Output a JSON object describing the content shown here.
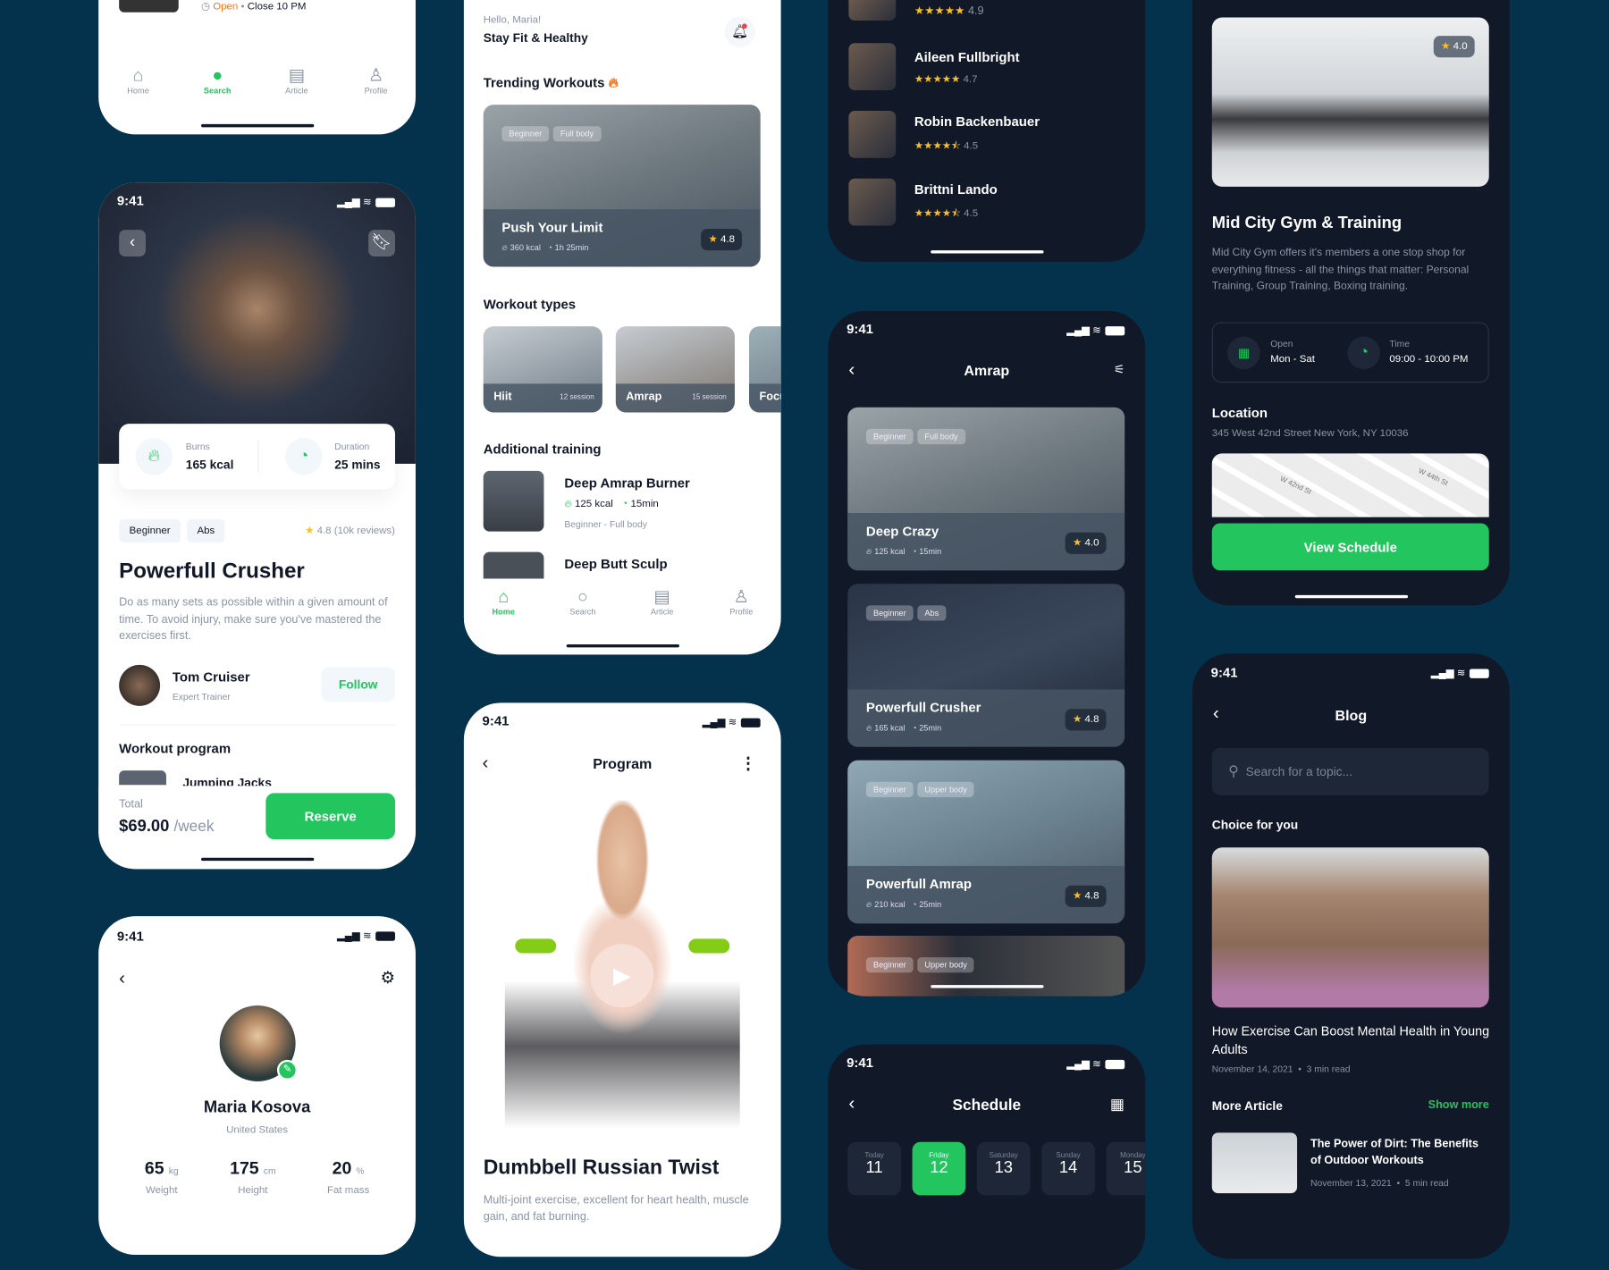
{
  "colors": {
    "background": "#04314b",
    "accent": "#22c55e",
    "dark_screen": "#111827",
    "star": "#fbbf24"
  },
  "status_time": "9:41",
  "gym_list": {
    "status_open": "Open",
    "closing": "Close 10 PM",
    "nav": [
      "Home",
      "Search",
      "Article",
      "Profile"
    ],
    "active_nav": "Search"
  },
  "detail": {
    "burns_label": "Burns",
    "burns": "165 kcal",
    "duration_label": "Duration",
    "duration": "25 mins",
    "tags": [
      "Beginner",
      "Abs"
    ],
    "rating": "4.8 (10k reviews)",
    "title": "Powerfull Crusher",
    "description": "Do as many sets as possible within a given amount of time. To avoid injury, make sure you've mastered the exercises first.",
    "trainer_name": "Tom Cruiser",
    "trainer_role": "Expert Trainer",
    "follow": "Follow",
    "program_heading": "Workout program",
    "program_item": "Jumping Jacks",
    "total_label": "Total",
    "price": "$69.00",
    "period": "/week",
    "reserve": "Reserve"
  },
  "profile": {
    "name": "Maria Kosova",
    "country": "United States",
    "stats": [
      {
        "value": "65",
        "unit": "kg",
        "label": "Weight"
      },
      {
        "value": "175",
        "unit": "cm",
        "label": "Height"
      },
      {
        "value": "20",
        "unit": "%",
        "label": "Fat mass"
      }
    ]
  },
  "home": {
    "greeting": "Hello, Maria!",
    "subtitle": "Stay Fit & Healthy",
    "trending_heading": "Trending Workouts",
    "trending": {
      "tags": [
        "Beginner",
        "Full body"
      ],
      "title": "Push Your Limit",
      "kcal": "360 kcal",
      "time": "1h 25min",
      "rating": "4.8"
    },
    "types_heading": "Workout types",
    "types": [
      {
        "name": "Hiit",
        "sessions": "12 session"
      },
      {
        "name": "Amrap",
        "sessions": "15 session"
      },
      {
        "name": "Focus",
        "sessions": ""
      }
    ],
    "additional_heading": "Additional training",
    "additional": [
      {
        "title": "Deep Amrap Burner",
        "kcal": "125 kcal",
        "time": "15min",
        "level": "Beginner - Full body"
      },
      {
        "title": "Deep Butt Sculp"
      }
    ],
    "nav": [
      "Home",
      "Search",
      "Article",
      "Profile"
    ],
    "active_nav": "Home"
  },
  "program": {
    "title": "Program",
    "exercise": "Dumbbell Russian Twist",
    "description": "Multi-joint exercise, excellent for heart health, muscle gain, and fat burning."
  },
  "trainers": [
    {
      "name": "",
      "rating": "4.9"
    },
    {
      "name": "Aileen Fullbright",
      "rating": "4.7"
    },
    {
      "name": "Robin Backenbauer",
      "rating": "4.5"
    },
    {
      "name": "Brittni Lando",
      "rating": "4.5"
    }
  ],
  "amrap": {
    "title": "Amrap",
    "cards": [
      {
        "tags": [
          "Beginner",
          "Full body"
        ],
        "title": "Deep Crazy",
        "kcal": "125 kcal",
        "time": "15min",
        "rating": "4.0"
      },
      {
        "tags": [
          "Beginner",
          "Abs"
        ],
        "title": "Powerfull Crusher",
        "kcal": "165 kcal",
        "time": "25min",
        "rating": "4.8"
      },
      {
        "tags": [
          "Beginner",
          "Upper body"
        ],
        "title": "Powerfull Amrap",
        "kcal": "210 kcal",
        "time": "25min",
        "rating": "4.8"
      },
      {
        "tags": [
          "Beginner",
          "Upper body"
        ]
      }
    ]
  },
  "schedule": {
    "title": "Schedule",
    "days": [
      {
        "label": "Today",
        "num": "11"
      },
      {
        "label": "Friday",
        "num": "12"
      },
      {
        "label": "Saturday",
        "num": "13"
      },
      {
        "label": "Sunday",
        "num": "14"
      },
      {
        "label": "Monday",
        "num": "15"
      }
    ],
    "selected": "12"
  },
  "gym": {
    "rating": "4.0",
    "name": "Mid City Gym & Training",
    "description": "Mid City Gym offers it's members a one stop shop for everything fitness - all the things that matter: Personal Training, Group Training, Boxing training.",
    "open_label": "Open",
    "open_days": "Mon - Sat",
    "time_label": "Time",
    "hours": "09:00 - 10:00 PM",
    "location_heading": "Location",
    "address": "345 West 42nd Street New York, NY 10036",
    "map_labels": [
      "W 42nd St",
      "W 44th St"
    ],
    "cta": "View Schedule"
  },
  "blog": {
    "title": "Blog",
    "search_placeholder": "Search for a topic...",
    "choice_heading": "Choice for you",
    "featured": {
      "title": "How Exercise Can Boost Mental Health in Young Adults",
      "date": "November 14, 2021",
      "read": "3 min read"
    },
    "more_heading": "More Article",
    "show_more": "Show more",
    "articles": [
      {
        "title": "The Power of Dirt: The Benefits of Outdoor Workouts",
        "date": "November 13, 2021",
        "read": "5 min read"
      }
    ]
  }
}
